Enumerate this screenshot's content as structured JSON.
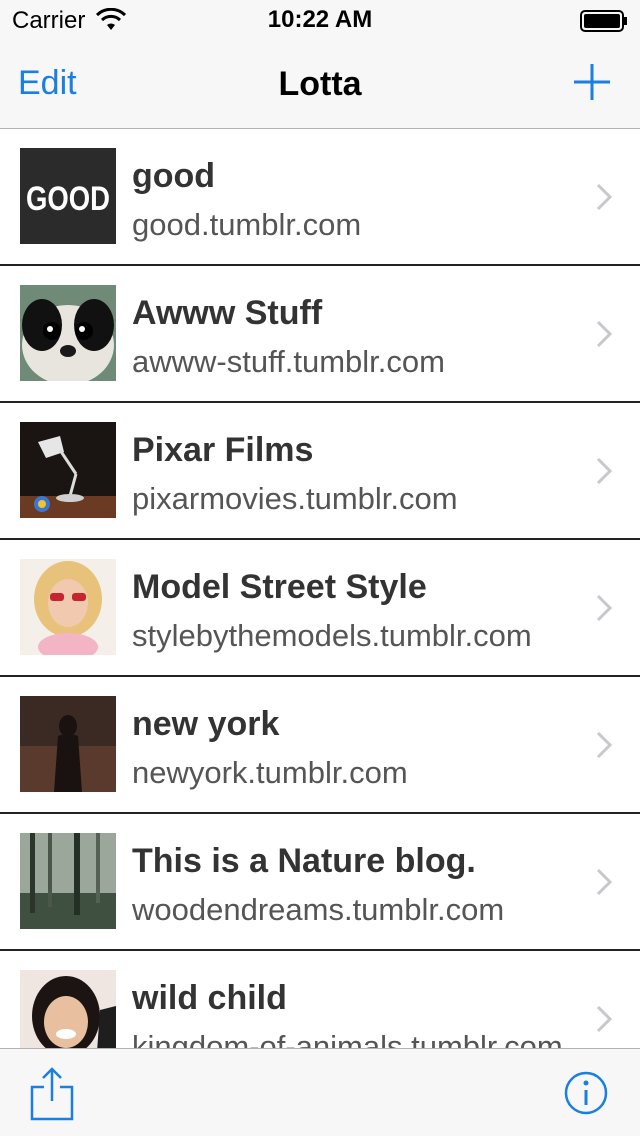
{
  "status_bar": {
    "carrier": "Carrier",
    "time": "10:22 AM",
    "wifi_icon": "wifi-icon",
    "battery_icon": "battery-icon"
  },
  "nav": {
    "edit_label": "Edit",
    "title": "Lotta",
    "add_icon": "plus-icon"
  },
  "blogs": [
    {
      "title": "good",
      "url": "good.tumblr.com",
      "thumb": "good-logo"
    },
    {
      "title": "Awww Stuff",
      "url": "awww-stuff.tumblr.com",
      "thumb": "puppy"
    },
    {
      "title": "Pixar Films",
      "url": "pixarmovies.tumblr.com",
      "thumb": "pixar-lamp"
    },
    {
      "title": "Model Street Style",
      "url": "stylebythemodels.tumblr.com",
      "thumb": "model"
    },
    {
      "title": "new york",
      "url": "newyork.tumblr.com",
      "thumb": "forest-figure"
    },
    {
      "title": "This is a Nature blog.",
      "url": "woodendreams.tumblr.com",
      "thumb": "foggy-forest"
    },
    {
      "title": "wild child",
      "url": "kingdom-of-animals.tumblr.com",
      "thumb": "girl-portrait"
    }
  ],
  "thumb_text": {
    "good_logo": "GOOD"
  },
  "toolbar": {
    "share_icon": "share-icon",
    "info_icon": "info-icon"
  },
  "colors": {
    "accent": "#1a7fe0",
    "bar_bg": "#f7f7f7",
    "separator": "#222222"
  }
}
